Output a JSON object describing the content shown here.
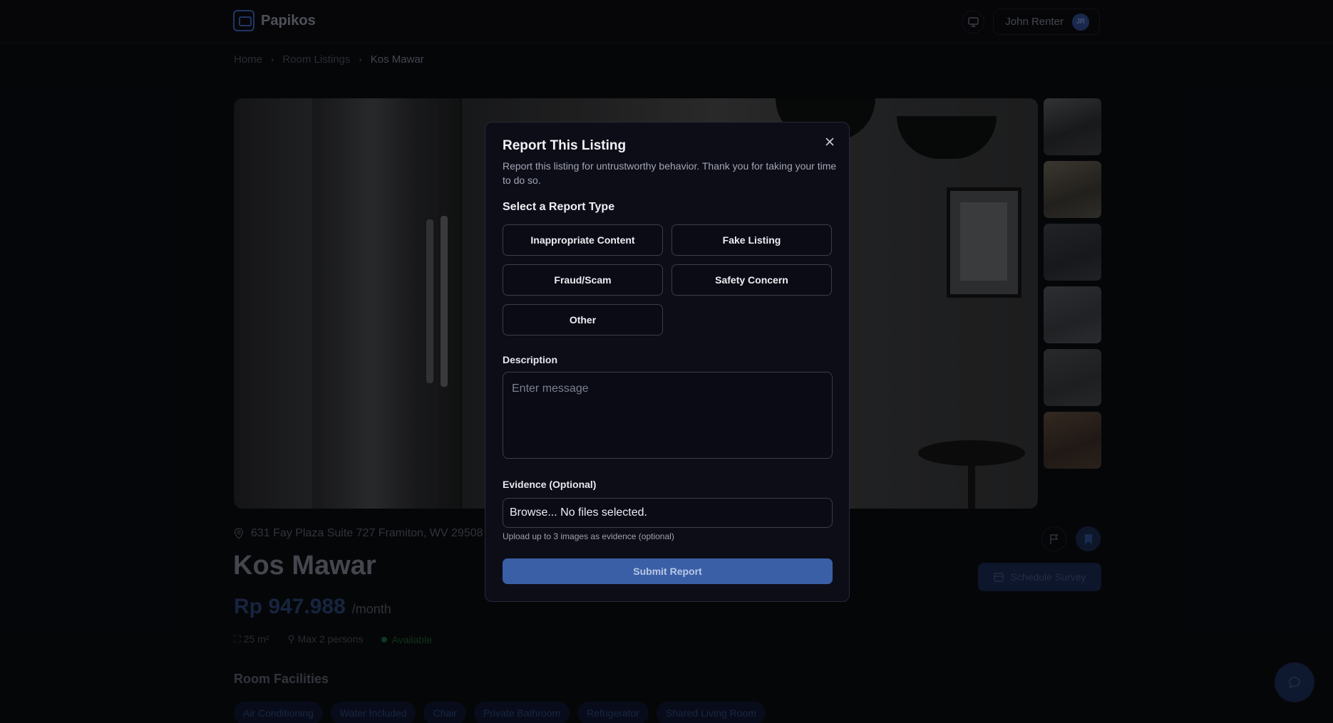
{
  "brand": {
    "name": "Papikos"
  },
  "header": {
    "user_name": "John Renter",
    "user_initials": "JR"
  },
  "breadcrumb": {
    "home": "Home",
    "listings": "Room Listings",
    "current": "Kos Mawar"
  },
  "listing": {
    "address": "631 Fay Plaza Suite 727 Framiton, WV 29508",
    "title": "Kos Mawar",
    "price": "Rp 947.988",
    "per": "/month",
    "size": "25 m²",
    "capacity": "Max 2 persons",
    "status": "Available",
    "facilities_title": "Room Facilities",
    "facilities": [
      "Air Conditioning",
      "Water Included",
      "Chair",
      "Private Bathroom",
      "Refrigerator",
      "Shared Living Room"
    ],
    "schedule_label": "Schedule Survey"
  },
  "modal": {
    "title": "Report This Listing",
    "description": "Report this listing for untrustworthy behavior. Thank you for taking your time to do so.",
    "type_label": "Select a Report Type",
    "types": [
      "Inappropriate Content",
      "Fake Listing",
      "Fraud/Scam",
      "Safety Concern",
      "Other"
    ],
    "description_label": "Description",
    "description_placeholder": "Enter message",
    "evidence_label": "Evidence (Optional)",
    "file_text": "Browse... No files selected.",
    "file_hint": "Upload up to 3 images as evidence (optional)",
    "submit_label": "Submit Report"
  },
  "colors": {
    "accent": "#3a5fa6",
    "modal_bg": "#0c0d17",
    "status_green": "#1b6b39"
  }
}
